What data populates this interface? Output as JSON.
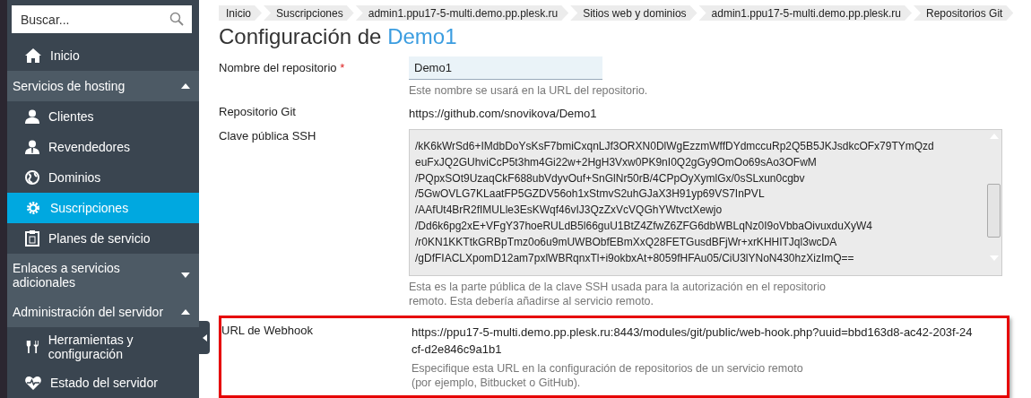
{
  "sidebar": {
    "search": {
      "placeholder": "Buscar..."
    },
    "items": [
      {
        "kind": "item",
        "label": "Inicio",
        "selected": false
      },
      {
        "kind": "section",
        "label": "Servicios de hosting",
        "expanded": true
      },
      {
        "kind": "item",
        "label": "Clientes",
        "selected": false
      },
      {
        "kind": "item",
        "label": "Revendedores",
        "selected": false
      },
      {
        "kind": "item",
        "label": "Dominios",
        "selected": false
      },
      {
        "kind": "item",
        "label": "Suscripciones",
        "selected": true
      },
      {
        "kind": "item",
        "label": "Planes de servicio",
        "selected": false
      },
      {
        "kind": "section",
        "label": "Enlaces a servicios adicionales",
        "expanded": false
      },
      {
        "kind": "section",
        "label": "Administración del servidor",
        "expanded": true
      },
      {
        "kind": "item",
        "label": "Herramientas y configuración",
        "selected": false
      },
      {
        "kind": "item",
        "label": "Estado del servidor",
        "selected": false
      }
    ]
  },
  "breadcrumbs": [
    "Inicio",
    "Suscripciones",
    "admin1.ppu17-5-multi.demo.pp.plesk.ru",
    "Sitios web y dominios",
    "admin1.ppu17-5-multi.demo.pp.plesk.ru",
    "Repositorios Git"
  ],
  "title": {
    "prefix": "Configuración de",
    "name": "Demo1"
  },
  "form": [
    {
      "kind": "input",
      "label": "Nombre del repositorio",
      "required": true,
      "required_mark": "*",
      "value": "Demo1",
      "hint": "Este nombre se usará en la URL del repositorio."
    },
    {
      "kind": "text",
      "label": "Repositorio Git",
      "value": "https://github.com/snovikova/Demo1"
    },
    {
      "kind": "textarea",
      "label": "Clave pública SSH",
      "lines": [
        "/kK6kWrSd6+IMdbDoYsKsF7bmiCxqnLJf3ORXN0DlWgEzzmWffDYdmccuRp2Q5B5JKJsdkcOFx79TYmQzd",
        "euFxJQ2GUhviCcP5t3hm4Gi22w+2HgH3Vxw0PK9nI0Q2gGy9OmOo69sAo3OFwM",
        "/PQpxSOt9UzaqCkF688ubVdyvOuf+SnGlNr50rB/4CPpOyXymlGx/0sSLxun0cgbv",
        "/5GwOVLG7KLaatFP5GZDV56oh1xStmvS2uhGJaX3H91yp69VS7InPVL",
        "/AAfUt4BrR2fIMULle3EsKWqf46vIJ3QzZxVcVQGhYWtvctXewjo",
        "/Dd6k6pg2xE+VFgY37hoeRULdB5l66guU1BtZ4ZfwZ6ZFG6dbWBLqNz0I9oVbbaOivuxduXyW4",
        "/r0KN1KKTtkGRBpTmz0o6u9mUWBObfEBmXxQ28FETGusdBFjWr+xrKHHITJql3wcDA",
        "/gDfFIACLXpomD12am7pxlWBRqnxTl+i9okbxAt+8059fHFAu05/CiU3lYNoN430hzXizImQ=="
      ],
      "hint": "Esta es la parte pública de la clave SSH usada para la autorización en el repositorio remoto. Esta debería añadirse al servicio remoto."
    },
    {
      "kind": "text",
      "label": "URL de Webhook",
      "highlighted": true,
      "value": "https://ppu17-5-multi.demo.pp.plesk.ru:8443/modules/git/public/web-hook.php?uuid=bbd163d8-ac42-203f-24cf-d2e846c9a1b1",
      "hint": "Especifique esta URL en la configuración de repositorios de un servicio remoto (por ejemplo, Bitbucket o GitHub)."
    }
  ]
}
